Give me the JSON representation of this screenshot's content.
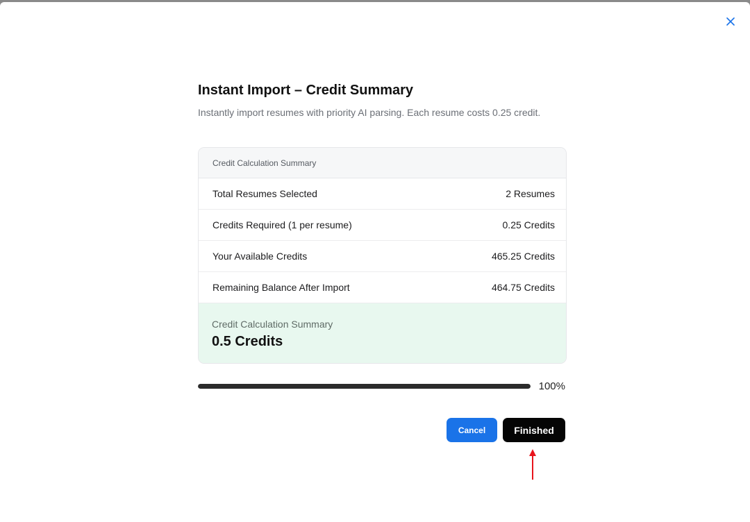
{
  "dialog": {
    "title": "Instant Import – Credit Summary",
    "subtitle": "Instantly import resumes with priority AI parsing. Each resume costs 0.25 credit.",
    "close_icon": "close-icon"
  },
  "summary": {
    "header": "Credit Calculation Summary",
    "rows": [
      {
        "label": "Total Resumes Selected",
        "value": "2 Resumes"
      },
      {
        "label": "Credits Required (1 per resume)",
        "value": "0.25 Credits"
      },
      {
        "label": "Your Available Credits",
        "value": "465.25 Credits"
      },
      {
        "label": "Remaining Balance After Import",
        "value": "464.75 Credits"
      }
    ],
    "total_label": "Credit Calculation Summary",
    "total_value": "0.5 Credits"
  },
  "progress": {
    "percent": 100,
    "label": "100%"
  },
  "buttons": {
    "cancel": "Cancel",
    "finished": "Finished"
  },
  "colors": {
    "accent_blue": "#1a73e8",
    "primary_black": "#050505",
    "total_bg": "#e8f8ef",
    "annotation_red": "#e8141c"
  }
}
